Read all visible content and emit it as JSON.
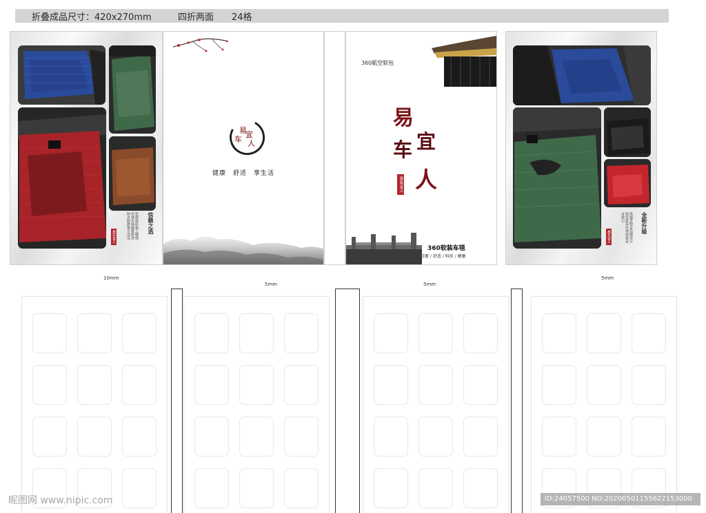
{
  "header": {
    "size_label": "折叠成品尺寸：420x270mm",
    "fold_label": "四折两面",
    "grid_label": "24格"
  },
  "panel1": {
    "badge": "信赖之选",
    "body_text": "优质面料做工精细环保无味健康舒适防水耐磨易于清洁",
    "seal_text": "易车宜人"
  },
  "panel2": {
    "logo_text": [
      "易",
      "车",
      "宜",
      "人"
    ],
    "slogan": "健康　舒适　享生活"
  },
  "panel3": {
    "subtitle": "360航空软包",
    "brand": [
      "易",
      "车",
      "宜",
      "人"
    ],
    "seal_text": "易车宜人",
    "product": "360软装车毯",
    "features": "轻奢 / 舒适 / 科技 / 健康"
  },
  "panel4": {
    "badge": "全新升级",
    "body_text": "高端定制全包围设计贴合原车环保材质安全放心",
    "seal_text": "易车宜人"
  },
  "dimensions": [
    "10mm",
    "5mm",
    "5mm",
    "5mm"
  ],
  "watermark": {
    "site": "昵图网 www.nipic.com",
    "id": "ID:24057500 NO:20200501155622153000"
  },
  "colors": {
    "mat_blue": "#2a4a9a",
    "mat_green": "#3f6a4a",
    "mat_red": "#a82428",
    "mat_brown": "#8a4b2a",
    "brand_red": "#7a1418"
  }
}
